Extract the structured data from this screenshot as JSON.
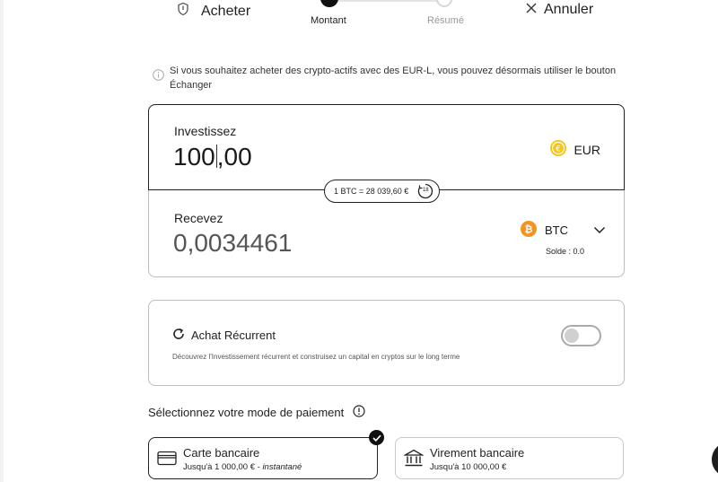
{
  "header": {
    "buy_label": "Acheter",
    "cancel_label": "Annuler",
    "steps": [
      {
        "label": "Montant",
        "active": true
      },
      {
        "label": "Résumé",
        "active": false
      }
    ]
  },
  "info": {
    "text": "Si vous souhaitez acheter des crypto-actifs avec des EUR-L, vous pouvez désormais utiliser le bouton Échanger"
  },
  "amount": {
    "invest_label": "Investissez",
    "invest_int": "100",
    "invest_dec": ",00",
    "invest_currency": "EUR",
    "rate": "1 BTC = 28 039,60 €",
    "rate_timer": "18",
    "receive_label": "Recevez",
    "receive_value": "0,0034461",
    "receive_currency": "BTC",
    "balance": "Solde : 0.0"
  },
  "recurring": {
    "title": "Achat Récurrent",
    "description": "Découvrez l'Investissement récurrent et construisez un capital en cryptos sur le long terme",
    "enabled": false
  },
  "payment": {
    "title": "Sélectionnez votre mode de paiement",
    "methods": [
      {
        "name": "Carte bancaire",
        "limit": "Jusqu'à 1 000,00 € - ",
        "speed": "instantané",
        "selected": true
      },
      {
        "name": "Virement bancaire",
        "limit": "Jusqu'à 10 000,00 €",
        "speed": "",
        "selected": false
      }
    ]
  },
  "colors": {
    "eur_coin": "#f5c518",
    "btc_coin": "#f39321",
    "border_active": "#222222",
    "border_muted": "#bdbdbd"
  }
}
